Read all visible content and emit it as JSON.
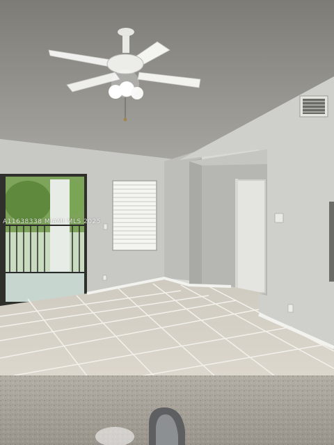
{
  "photo": {
    "watermark": "A11638338 MIAMI MLS 2025",
    "subject": "Empty living room",
    "colors": {
      "ceiling": "#8f8d87",
      "wall": "#c9cac5",
      "wall_shadow": "#b4b5b0",
      "floor_tile": "#d5d0c4",
      "grout": "#f3f1ec",
      "counter": "#a9a49b",
      "door": "#e6e6e2",
      "trees": "#6f9a48"
    },
    "icons": [
      "ceiling-fan-icon",
      "light-fixture-icon",
      "window-blinds-icon",
      "air-vent-icon",
      "thermostat-icon",
      "outlet-icon",
      "faucet-icon"
    ]
  }
}
